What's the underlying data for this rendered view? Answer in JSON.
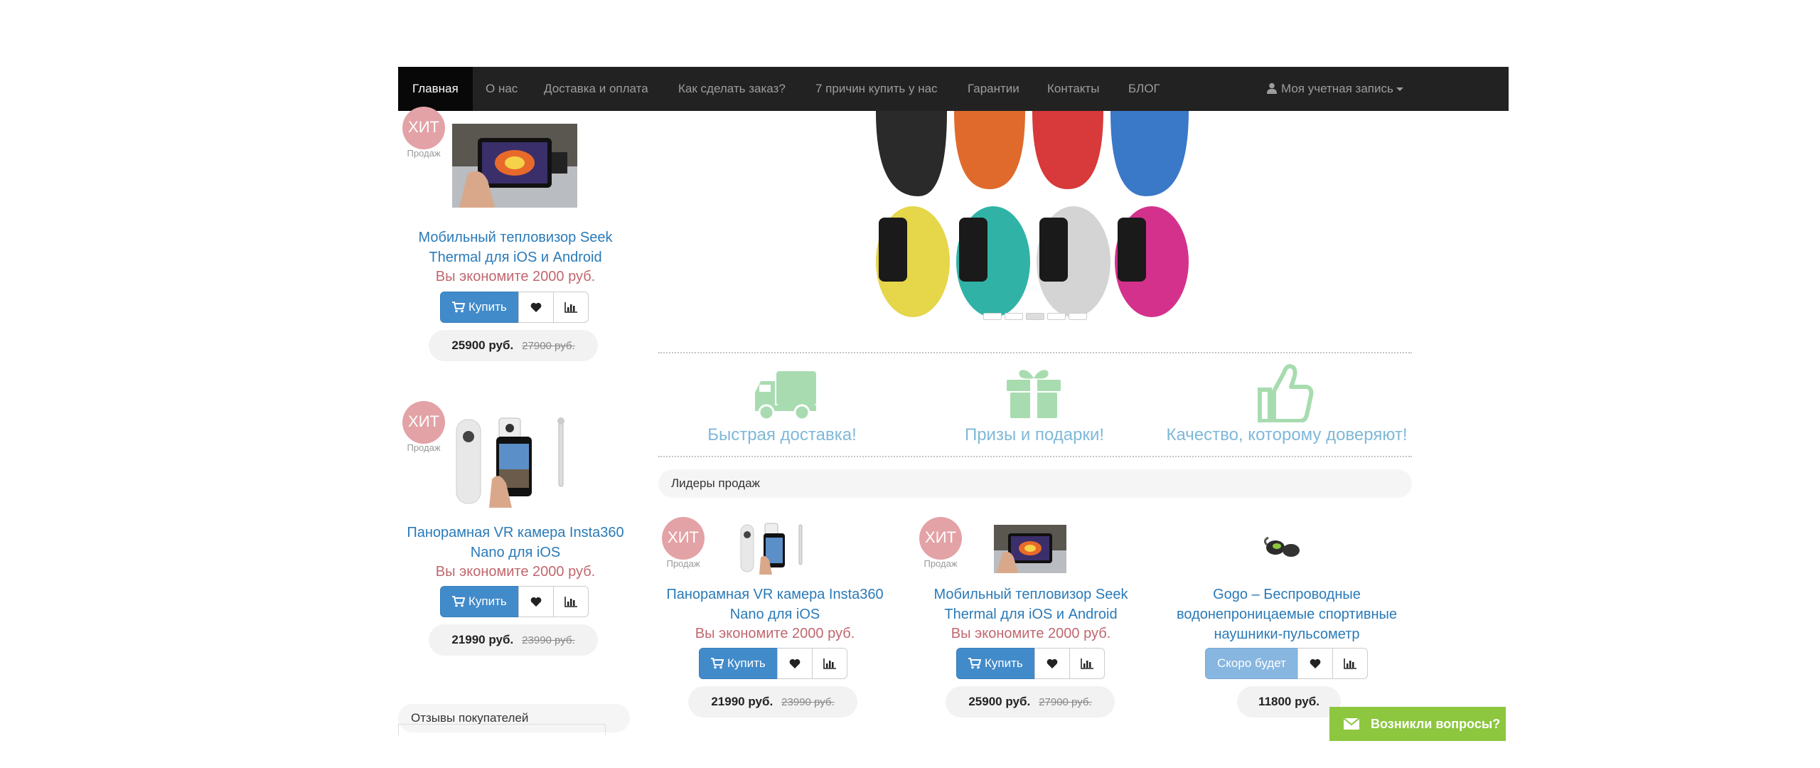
{
  "nav": {
    "items": [
      "Главная",
      "О нас",
      "Доставка и оплата",
      "Как сделать заказ?",
      "7 причин купить у нас",
      "Гарантии",
      "Контакты",
      "БЛОГ"
    ],
    "account": "Моя учетная запись"
  },
  "badge": {
    "hit": "ХИТ",
    "sub": "Продаж"
  },
  "sidebar": {
    "products": [
      {
        "title": "Мобильный тепловизор Seek Thermal для iOS и Android",
        "save": "Вы экономите 2000 руб.",
        "price": "25900 руб.",
        "old_price": "27900 руб."
      },
      {
        "title": "Панорамная VR камера Insta360 Nano для iOS",
        "save": "Вы экономите 2000 руб.",
        "price": "21990 руб.",
        "old_price": "23990 руб."
      }
    ],
    "reviews_title": "Отзывы покупателей"
  },
  "buttons": {
    "buy": "Купить",
    "soon": "Скоро будет"
  },
  "features": [
    {
      "icon": "truck-icon",
      "label": "Быстрая доставка!"
    },
    {
      "icon": "gift-icon",
      "label": "Призы и подарки!"
    },
    {
      "icon": "thumbs-up-icon",
      "label": "Качество, которому доверяют!"
    }
  ],
  "leaders": {
    "title": "Лидеры продаж",
    "products": [
      {
        "title": "Панорамная VR камера Insta360 Nano для iOS",
        "save": "Вы экономите 2000 руб.",
        "price": "21990 руб.",
        "old_price": "23990 руб."
      },
      {
        "title": "Мобильный тепловизор Seek Thermal для iOS и Android",
        "save": "Вы экономите 2000 руб.",
        "price": "25900 руб.",
        "old_price": "27900 руб."
      },
      {
        "title": "Gogo – Беспроводные водонепроницаемые спортивные наушники-пульсометр",
        "price": "11800 руб."
      }
    ]
  },
  "chat": {
    "label": "Возникли вопросы?"
  },
  "colors": {
    "feature_green": "#a8dcb0",
    "link_blue": "#2a7ab8",
    "save_red": "#c0676e",
    "hit_pink": "#e3a2a6",
    "chat_green": "#8dc63f"
  }
}
